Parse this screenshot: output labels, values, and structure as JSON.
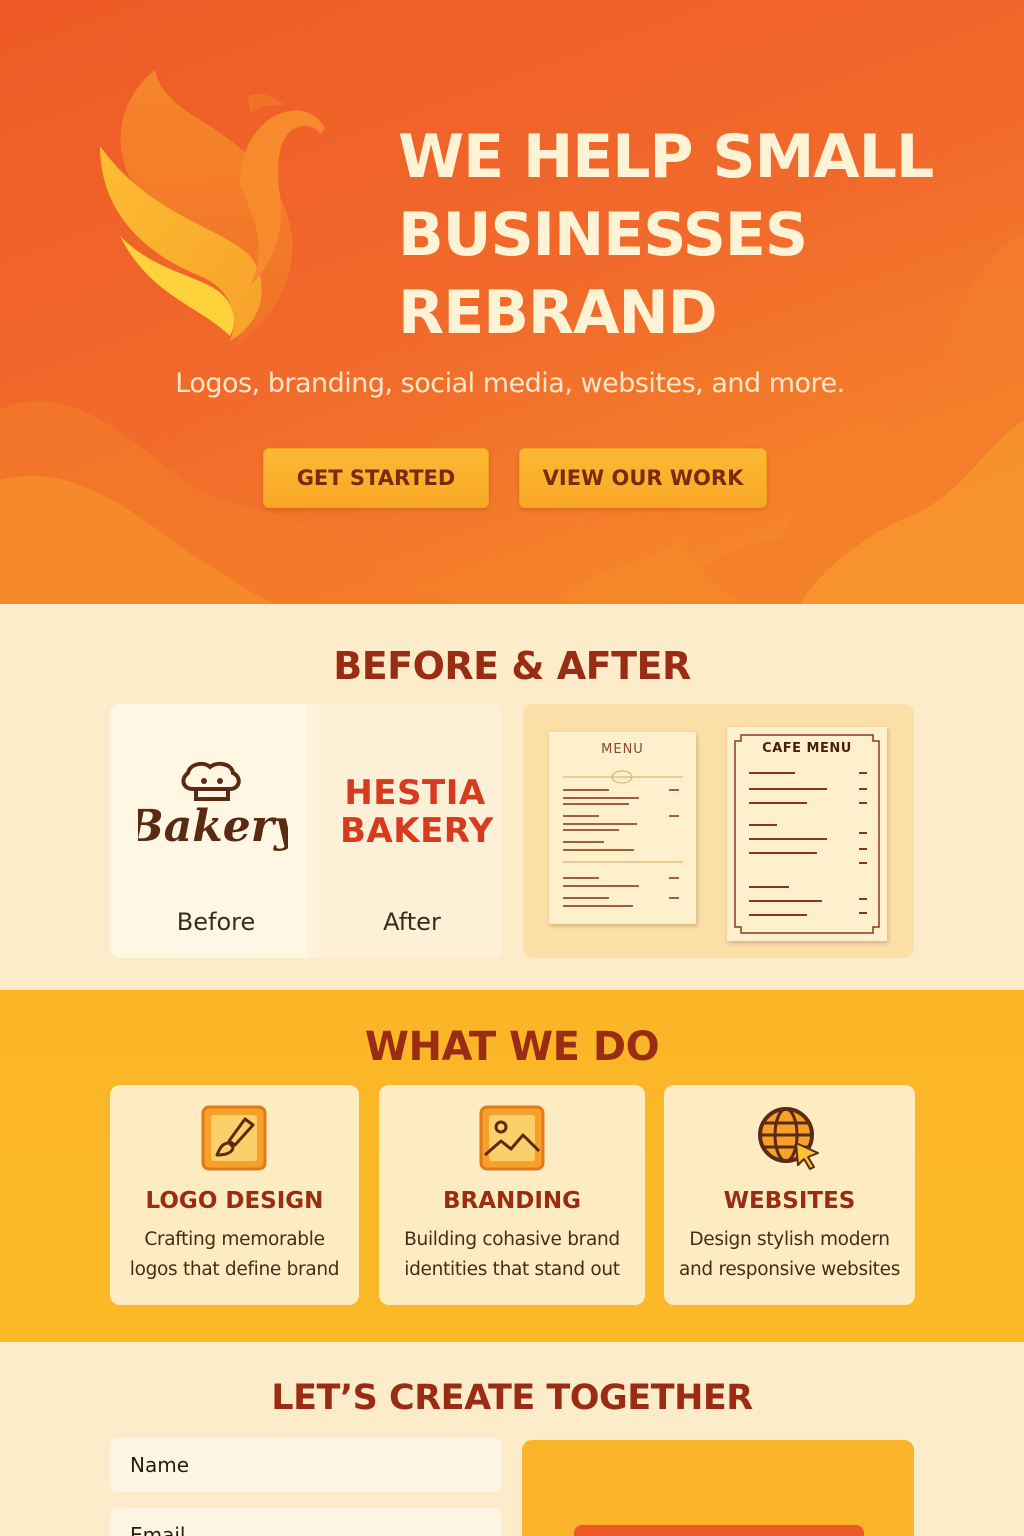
{
  "hero": {
    "title_lines": [
      "WE HELP SMALL",
      "BUSINESSES",
      "REBRAND"
    ],
    "subtitle": "Logos, branding, social media, websites, and more.",
    "buttons": {
      "get_started": "GET STARTED",
      "view_work": "VIEW OUR WORK"
    },
    "logo_icon": "phoenix-icon"
  },
  "before_after": {
    "title": "BEFORE & AFTER",
    "old_logo_text": "Bakery",
    "new_logo_lines": [
      "HESTIA",
      "BAKERY"
    ],
    "before_label": "Before",
    "after_label": "After",
    "old_menu_title": "MENU",
    "new_menu_title": "CAFE MENU"
  },
  "services": {
    "title": "WHAT WE DO",
    "items": [
      {
        "icon": "brush-icon",
        "name": "LOGO DESIGN",
        "desc": [
          "Crafting memorable",
          "logos that define brand"
        ]
      },
      {
        "icon": "image-icon",
        "name": "BRANDING",
        "desc": [
          "Building cohasive brand",
          "identities that stand out"
        ]
      },
      {
        "icon": "globe-cursor-icon",
        "name": "WEBSITES",
        "desc": [
          "Design stylish modern",
          "and responsive websites"
        ]
      }
    ]
  },
  "contact": {
    "title": "LET’S CREATE TOGETHER",
    "name_placeholder": "Name",
    "email_placeholder": "Email"
  },
  "colors": {
    "hero_orange": "#ee5a26",
    "accent_yellow": "#fbb628",
    "cream": "#fdecca",
    "title_red": "#9b2c14"
  }
}
